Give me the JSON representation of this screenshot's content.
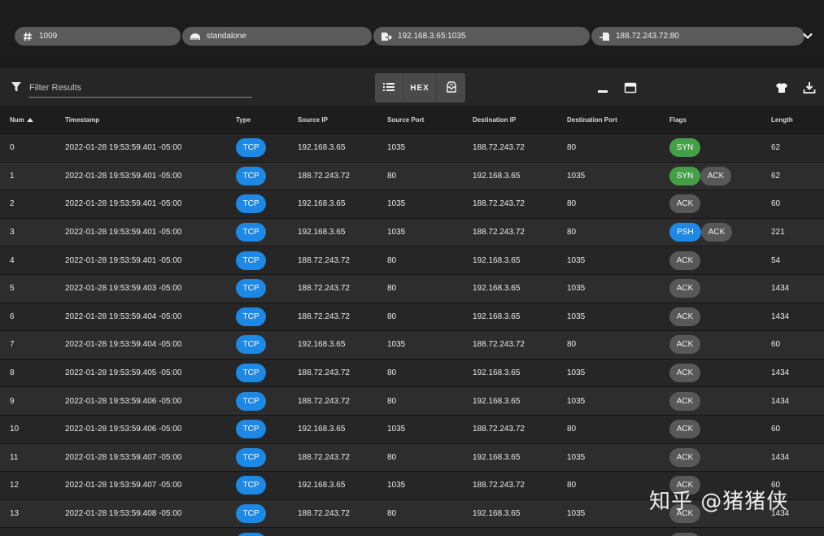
{
  "session": {
    "count": "1009",
    "mode": "standalone",
    "source": "192.168.3.65:1035",
    "destination": "188.72.243.72:80"
  },
  "toolbar": {
    "filter_placeholder": "Filter Results",
    "hex_label": "HEX"
  },
  "icons": {
    "count": "hash-icon",
    "mode": "router-icon",
    "source": "source-arrow-icon",
    "destination": "destination-arrow-icon",
    "expand": "chevron-down-icon",
    "filter": "filter-icon",
    "list": "list-view-icon",
    "split": "split-view-icon",
    "minimize": "minimize-icon",
    "panel": "panel-icon",
    "theme": "shirt-icon",
    "download": "download-icon"
  },
  "colors": {
    "tcp": "#1e88e5",
    "syn": "#43a047",
    "psh": "#1e88e5",
    "ack": "#585858"
  },
  "table": {
    "columns": {
      "num": "Num",
      "timestamp": "Timestamp",
      "type": "Type",
      "source_ip": "Source IP",
      "source_port": "Source Port",
      "destination_ip": "Destination IP",
      "destination_port": "Destination Port",
      "flags": "Flags",
      "length": "Length"
    },
    "sort": {
      "column": "Num",
      "direction": "ascending"
    },
    "rows": [
      {
        "num": "0",
        "timestamp": "2022-01-28 19:53:59.401 -05:00",
        "type": "TCP",
        "source_ip": "192.168.3.65",
        "source_port": "1035",
        "destination_ip": "188.72.243.72",
        "destination_port": "80",
        "flags": [
          "SYN"
        ],
        "length": "62"
      },
      {
        "num": "1",
        "timestamp": "2022-01-28 19:53:59.401 -05:00",
        "type": "TCP",
        "source_ip": "188.72.243.72",
        "source_port": "80",
        "destination_ip": "192.168.3.65",
        "destination_port": "1035",
        "flags": [
          "SYN",
          "ACK"
        ],
        "length": "62"
      },
      {
        "num": "2",
        "timestamp": "2022-01-28 19:53:59.401 -05:00",
        "type": "TCP",
        "source_ip": "192.168.3.65",
        "source_port": "1035",
        "destination_ip": "188.72.243.72",
        "destination_port": "80",
        "flags": [
          "ACK"
        ],
        "length": "60"
      },
      {
        "num": "3",
        "timestamp": "2022-01-28 19:53:59.401 -05:00",
        "type": "TCP",
        "source_ip": "192.168.3.65",
        "source_port": "1035",
        "destination_ip": "188.72.243.72",
        "destination_port": "80",
        "flags": [
          "PSH",
          "ACK"
        ],
        "length": "221"
      },
      {
        "num": "4",
        "timestamp": "2022-01-28 19:53:59.401 -05:00",
        "type": "TCP",
        "source_ip": "188.72.243.72",
        "source_port": "80",
        "destination_ip": "192.168.3.65",
        "destination_port": "1035",
        "flags": [
          "ACK"
        ],
        "length": "54"
      },
      {
        "num": "5",
        "timestamp": "2022-01-28 19:53:59.403 -05:00",
        "type": "TCP",
        "source_ip": "188.72.243.72",
        "source_port": "80",
        "destination_ip": "192.168.3.65",
        "destination_port": "1035",
        "flags": [
          "ACK"
        ],
        "length": "1434"
      },
      {
        "num": "6",
        "timestamp": "2022-01-28 19:53:59.404 -05:00",
        "type": "TCP",
        "source_ip": "188.72.243.72",
        "source_port": "80",
        "destination_ip": "192.168.3.65",
        "destination_port": "1035",
        "flags": [
          "ACK"
        ],
        "length": "1434"
      },
      {
        "num": "7",
        "timestamp": "2022-01-28 19:53:59.404 -05:00",
        "type": "TCP",
        "source_ip": "192.168.3.65",
        "source_port": "1035",
        "destination_ip": "188.72.243.72",
        "destination_port": "80",
        "flags": [
          "ACK"
        ],
        "length": "60"
      },
      {
        "num": "8",
        "timestamp": "2022-01-28 19:53:59.405 -05:00",
        "type": "TCP",
        "source_ip": "188.72.243.72",
        "source_port": "80",
        "destination_ip": "192.168.3.65",
        "destination_port": "1035",
        "flags": [
          "ACK"
        ],
        "length": "1434"
      },
      {
        "num": "9",
        "timestamp": "2022-01-28 19:53:59.406 -05:00",
        "type": "TCP",
        "source_ip": "188.72.243.72",
        "source_port": "80",
        "destination_ip": "192.168.3.65",
        "destination_port": "1035",
        "flags": [
          "ACK"
        ],
        "length": "1434"
      },
      {
        "num": "10",
        "timestamp": "2022-01-28 19:53:59.406 -05:00",
        "type": "TCP",
        "source_ip": "192.168.3.65",
        "source_port": "1035",
        "destination_ip": "188.72.243.72",
        "destination_port": "80",
        "flags": [
          "ACK"
        ],
        "length": "60"
      },
      {
        "num": "11",
        "timestamp": "2022-01-28 19:53:59.407 -05:00",
        "type": "TCP",
        "source_ip": "188.72.243.72",
        "source_port": "80",
        "destination_ip": "192.168.3.65",
        "destination_port": "1035",
        "flags": [
          "ACK"
        ],
        "length": "1434"
      },
      {
        "num": "12",
        "timestamp": "2022-01-28 19:53:59.407 -05:00",
        "type": "TCP",
        "source_ip": "192.168.3.65",
        "source_port": "1035",
        "destination_ip": "188.72.243.72",
        "destination_port": "80",
        "flags": [
          "ACK"
        ],
        "length": "60"
      },
      {
        "num": "13",
        "timestamp": "2022-01-28 19:53:59.408 -05:00",
        "type": "TCP",
        "source_ip": "188.72.243.72",
        "source_port": "80",
        "destination_ip": "192.168.3.65",
        "destination_port": "1035",
        "flags": [
          "ACK"
        ],
        "length": "1434"
      },
      {
        "num": "",
        "timestamp": "",
        "type": "TCP",
        "source_ip": "",
        "source_port": "",
        "destination_ip": "",
        "destination_port": "",
        "flags": [
          "ACK"
        ],
        "length": ""
      }
    ]
  },
  "watermark": "知乎 @猪猪侠"
}
